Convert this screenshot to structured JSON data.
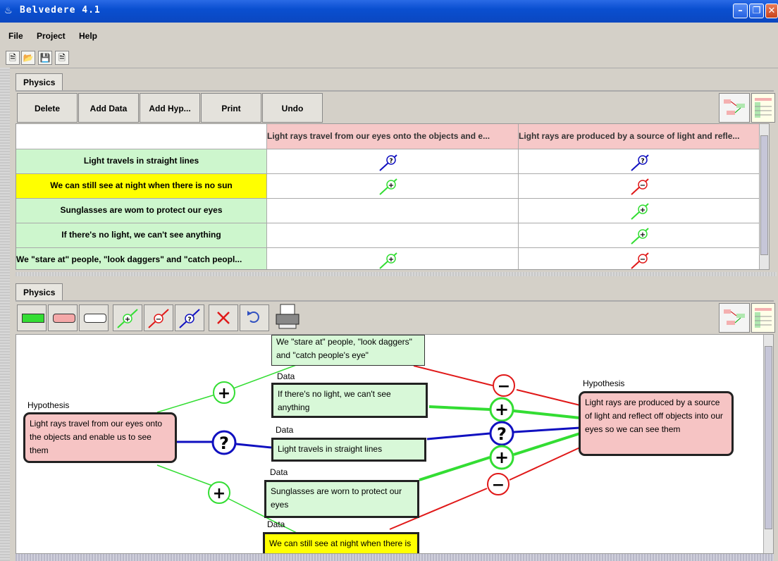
{
  "window": {
    "title": "Belvedere 4.1"
  },
  "menu": {
    "file": "File",
    "project": "Project",
    "help": "Help"
  },
  "toolbar_icons": [
    "new-icon",
    "open-icon",
    "save-icon",
    "export-icon"
  ],
  "matrix": {
    "tab": "Physics",
    "buttons": {
      "delete": "Delete",
      "add_data": "Add Data",
      "add_hyp": "Add Hyp...",
      "print": "Print",
      "undo": "Undo"
    },
    "columns": [
      "Light rays travel from our eyes onto the objects and e...",
      "Light rays are produced by a source of light and refle..."
    ],
    "rows": [
      {
        "label": "Light travels in straight lines",
        "highlight": false,
        "c1": "?",
        "c2": "?"
      },
      {
        "label": "We can still see at night when there is no sun",
        "highlight": true,
        "c1": "+",
        "c2": "-"
      },
      {
        "label": "Sunglasses are wom to protect our eyes",
        "highlight": false,
        "c1": "",
        "c2": "+"
      },
      {
        "label": "If there's no light, we can't see anything",
        "highlight": false,
        "c1": "",
        "c2": "+"
      },
      {
        "label": "We \"stare at\" people, \"look daggers\" and \"catch peopl...",
        "highlight": false,
        "c1": "+",
        "c2": "-"
      }
    ]
  },
  "graph": {
    "tab": "Physics",
    "tools": [
      "data-node-tool-icon",
      "hypothesis-node-tool-icon",
      "unspecified-node-tool-icon",
      "support-link-icon",
      "conflict-link-icon",
      "unknown-link-icon",
      "delete-icon",
      "undo-icon",
      "print-icon"
    ],
    "labels": {
      "hypothesis": "Hypothesis",
      "data": "Data"
    },
    "h1": "Light rays travel from our eyes onto the objects and enable us to see them",
    "h2": "Light rays are produced by a source of light and reflect off objects into our eyes so we can see them",
    "d_stare": "We \"stare at\" people, \"look daggers\" and \"catch people's eye\"",
    "d_nolight": "If there's no light, we can't see anything",
    "d_straight": "Light travels in straight lines",
    "d_sunglasses": "Sunglasses are worn to protect our eyes",
    "d_night": "We can still see at night when there is no sun"
  },
  "colors": {
    "support": "#33dd33",
    "conflict": "#e01818",
    "unknown": "#1010c0",
    "hypothesis_fill": "#f6c4c4",
    "data_fill": "#d8f8d8",
    "highlight_fill": "#ffff00"
  }
}
